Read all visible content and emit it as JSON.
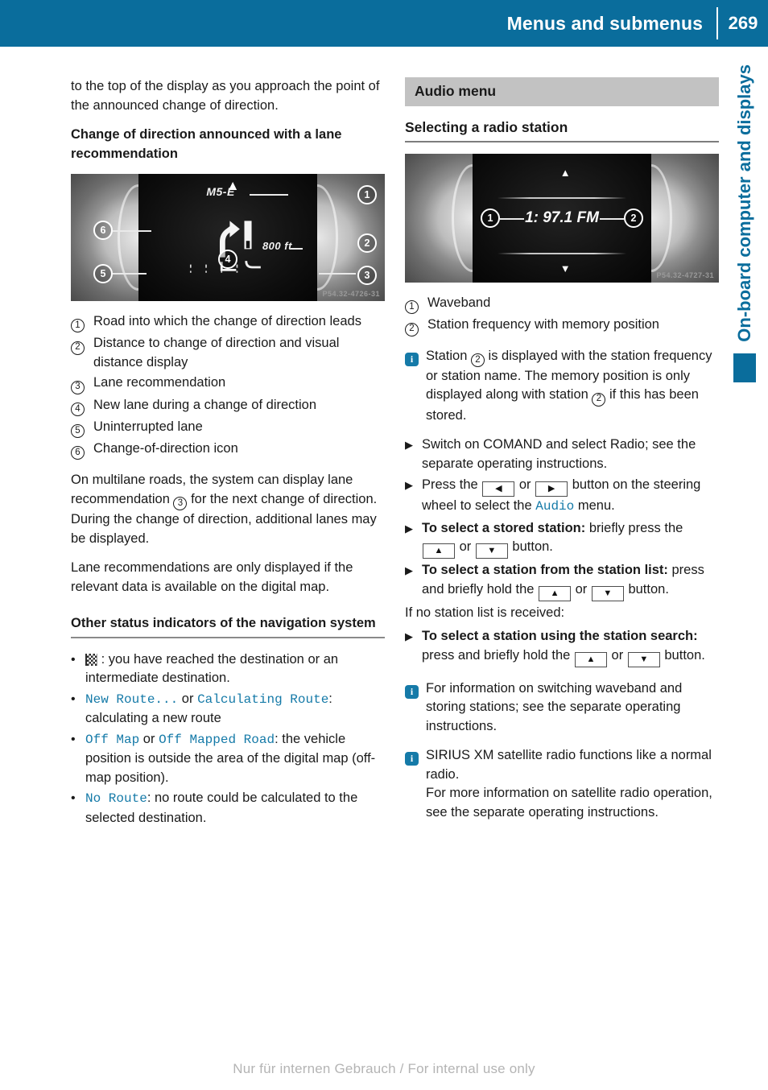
{
  "header": {
    "title": "Menus and submenus",
    "page_number": "269"
  },
  "side_tab": {
    "label": "On-board computer and displays"
  },
  "footer": {
    "watermark": "Nur für internen Gebrauch / For internal use only"
  },
  "left_column": {
    "intro_paragraph": "to the top of the display as you approach the point of the announced change of direction.",
    "heading_1": "Change of direction announced with a lane recommendation",
    "figure_nav": {
      "road_label": "M5-E",
      "distance_label": "800 ft",
      "image_code": "P54.32-4726-31",
      "callouts": [
        "1",
        "2",
        "3",
        "4",
        "5",
        "6"
      ]
    },
    "numbered_items": [
      {
        "num": "1",
        "text": "Road into which the change of direction leads"
      },
      {
        "num": "2",
        "text": "Distance to change of direction and visual distance display"
      },
      {
        "num": "3",
        "text": "Lane recommendation"
      },
      {
        "num": "4",
        "text": "New lane during a change of direction"
      },
      {
        "num": "5",
        "text": "Uninterrupted lane"
      },
      {
        "num": "6",
        "text": "Change-of-direction icon"
      }
    ],
    "paragraph_multilane_a": "On multilane roads, the system can display lane recommendation ",
    "paragraph_multilane_ref": "3",
    "paragraph_multilane_b": " for the next change of direction. During the change of direction, additional lanes may be displayed.",
    "paragraph_lane_rec": "Lane recommendations are only displayed if the relevant data is available on the digital map.",
    "heading_2": "Other status indicators of the navigation system",
    "bullets": [
      {
        "icon": "checkered-flag",
        "text": ": you have reached the destination or an intermediate destination."
      },
      {
        "display_1": "New Route...",
        "join": " or ",
        "display_2": "Calculating Route",
        "text": ": calculating a new route"
      },
      {
        "display_1": "Off Map",
        "join": " or ",
        "display_2": "Off Mapped Road",
        "text": ": the vehicle position is outside the area of the digital map (off-map position)."
      },
      {
        "display_1": "No Route",
        "text": ": no route could be calculated to the selected destination."
      }
    ]
  },
  "right_column": {
    "section_heading": "Audio menu",
    "sub_heading": "Selecting a radio station",
    "figure_radio": {
      "station_text": "1: 97.1 FM",
      "image_code": "P54.32-4727-31",
      "callouts": [
        "1",
        "2"
      ]
    },
    "numbered_items": [
      {
        "num": "1",
        "text": "Waveband"
      },
      {
        "num": "2",
        "text": "Station frequency with memory position"
      }
    ],
    "note_station_a": "Station ",
    "note_station_ref1": "2",
    "note_station_b": " is displayed with the station frequency or station name. The memory position is only displayed along with station ",
    "note_station_ref2": "2",
    "note_station_c": " if this has been stored.",
    "steps": [
      {
        "text_before": "Switch on COMAND and select Radio; see the separate operating instructions."
      },
      {
        "text_before": "Press the ",
        "key_1": "◀",
        "join_1": " or ",
        "key_2": "▶",
        "text_after": " button on the steering wheel to select the ",
        "display": "Audio",
        "text_end": " menu."
      },
      {
        "bold_label": "To select a stored station:",
        "text_before": " briefly press the ",
        "key_1": "▲",
        "join_1": " or ",
        "key_2": "▼",
        "text_after": " button."
      },
      {
        "bold_label": "To select a station from the station list:",
        "text_before": " press and briefly hold the ",
        "key_1": "▲",
        "join_1": " or ",
        "key_2": "▼",
        "text_after": " button."
      }
    ],
    "no_station_line": "If no station list is received:",
    "step_search": {
      "bold_label": "To select a station using the station search:",
      "text_before": " press and briefly hold the ",
      "key_1": "▲",
      "join_1": " or ",
      "key_2": "▼",
      "text_after": " button."
    },
    "note_waveband": "For information on switching waveband and storing stations; see the separate operating instructions.",
    "note_sirius": "SIRIUS XM satellite radio functions like a normal radio.",
    "note_sirius_more": "For more information on satellite radio operation, see the separate operating instructions."
  }
}
